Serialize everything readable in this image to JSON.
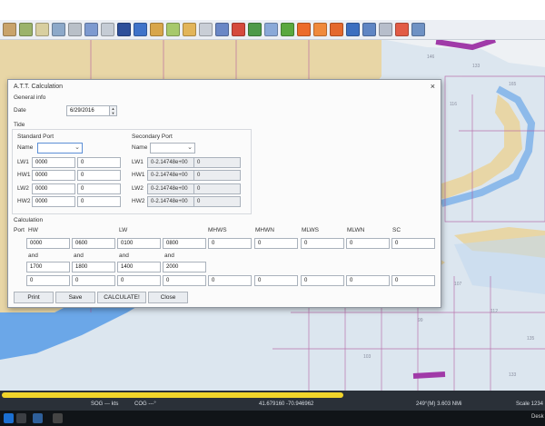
{
  "chart_app": {
    "statusbar": {
      "sog": "SOG --- kts",
      "cog": "COG ---°",
      "position": "41.679160  -70.946962",
      "bearing_distance": "249°(M)  3.603 NMi",
      "scale": "Scale 1234"
    },
    "taskbar": {
      "desktop_label": "Desk"
    }
  },
  "dialog": {
    "title": "A.T.T. Calculation",
    "close_glyph": "×",
    "general_info": {
      "heading": "General info",
      "date_label": "Date",
      "date_value": "6/29/2016"
    },
    "tide": {
      "heading": "Tide",
      "standard_port": {
        "heading": "Standard Port",
        "name_label": "Name",
        "rows": [
          {
            "label": "LW1",
            "a": "0000",
            "b": "0"
          },
          {
            "label": "HW1",
            "a": "0000",
            "b": "0"
          },
          {
            "label": "LW2",
            "a": "0000",
            "b": "0"
          },
          {
            "label": "HW2",
            "a": "0000",
            "b": "0"
          }
        ]
      },
      "secondary_port": {
        "heading": "Secondary Port",
        "name_label": "Name",
        "rows": [
          {
            "label": "LW1",
            "a": "0-2.14748e+00",
            "b": "0"
          },
          {
            "label": "HW1",
            "a": "0-2.14748e+00",
            "b": "0"
          },
          {
            "label": "LW2",
            "a": "0-2.14748e+00",
            "b": "0"
          },
          {
            "label": "HW2",
            "a": "0-2.14748e+00",
            "b": "0"
          }
        ]
      }
    },
    "calculation": {
      "heading": "Calculation",
      "port_label": "Port",
      "col_hw": "HW",
      "col_lw": "LW",
      "col_mhws": "MHWS",
      "col_mhwn": "MHWN",
      "col_mlws": "MLWS",
      "col_mlwn": "MLWN",
      "col_sc": "SC",
      "row1": [
        "0000",
        "0600",
        "0100",
        "0800",
        "0",
        "0",
        "0",
        "0",
        "0"
      ],
      "and_label": "and",
      "row2": [
        "1700",
        "1800",
        "1400",
        "2000"
      ],
      "row3": [
        "0",
        "0",
        "0",
        "0",
        "0",
        "0",
        "0",
        "0",
        "0"
      ]
    },
    "buttons": {
      "print": "Print",
      "save": "Save",
      "calculate": "CALCULATE!",
      "close": "Close"
    }
  }
}
